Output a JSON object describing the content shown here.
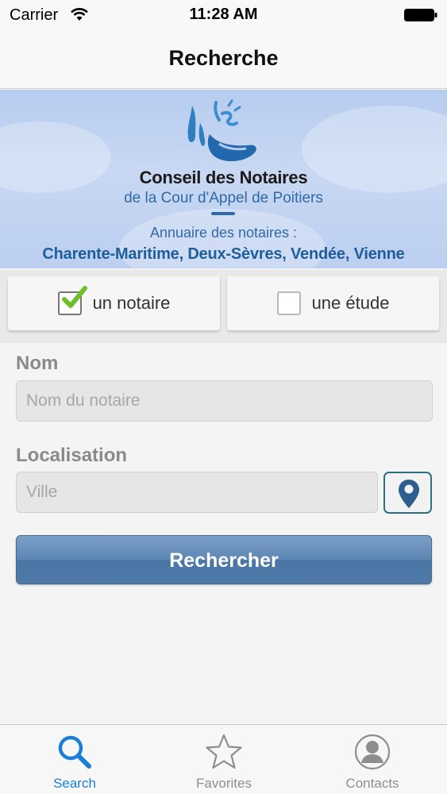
{
  "status_bar": {
    "carrier": "Carrier",
    "time": "11:28 AM"
  },
  "nav": {
    "title": "Recherche"
  },
  "banner": {
    "organization": "Conseil des Notaires",
    "court": "de la Cour d'Appel de Poitiers",
    "directory": "Annuaire des notaires :",
    "regions": "Charente-Maritime, Deux-Sèvres, Vendée, Vienne"
  },
  "toggles": [
    {
      "label": "un notaire",
      "checked": true
    },
    {
      "label": "une étude",
      "checked": false
    }
  ],
  "form": {
    "name_label": "Nom",
    "name_placeholder": "Nom du notaire",
    "location_label": "Localisation",
    "location_placeholder": "Ville",
    "search_button": "Rechercher"
  },
  "tabs": [
    {
      "label": "Search",
      "icon": "magnifier-icon",
      "active": true
    },
    {
      "label": "Favorites",
      "icon": "star-icon",
      "active": false
    },
    {
      "label": "Contacts",
      "icon": "person-icon",
      "active": false
    }
  ],
  "colors": {
    "accent": "#1a7fd6",
    "brand_blue": "#2f6aa8",
    "button": "#5d86b3",
    "teal_border": "#2b6f82"
  }
}
